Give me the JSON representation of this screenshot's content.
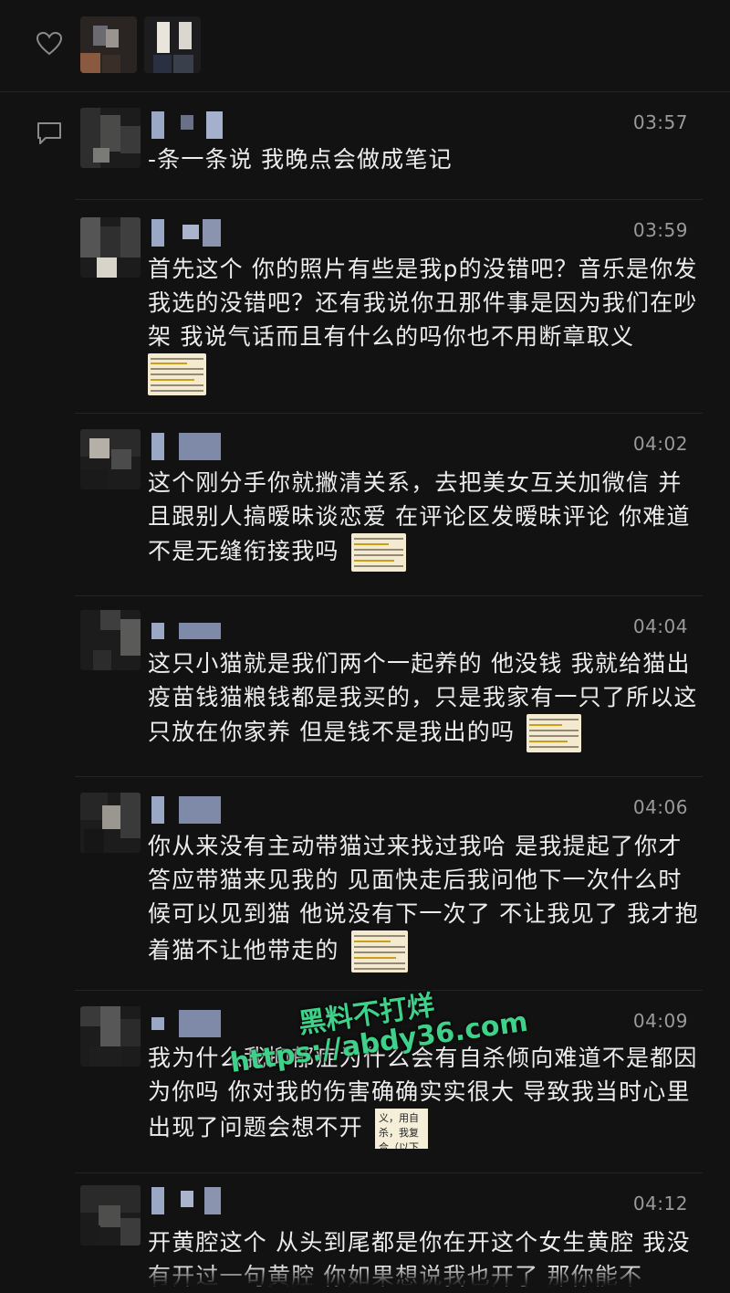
{
  "likes": {
    "icon": "heart-icon"
  },
  "comments_icon": "comment-icon",
  "watermark": {
    "line1": "黑料不打烊",
    "line2": "https://abdy36.com"
  },
  "comments": [
    {
      "time": "03:57",
      "text": "-条一条说 我晚点会做成笔记",
      "thumb": null
    },
    {
      "time": "03:59",
      "text": "首先这个 你的照片有些是我p的没错吧？音乐是你发我选的没错吧？还有我说你丑那件事是因为我们在吵架 我说气话而且有什么的吗你也不用断章取义",
      "thumb": "note"
    },
    {
      "time": "04:02",
      "text": "这个刚分手你就撇清关系，去把美女互关加微信 并且跟别人搞暧昧谈恋爱 在评论区发暧昧评论 你难道不是无缝衔接我吗",
      "thumb": "note"
    },
    {
      "time": "04:04",
      "text": "这只小猫就是我们两个一起养的 他没钱 我就给猫出疫苗钱猫粮钱都是我买的，只是我家有一只了所以这只放在你家养 但是钱不是我出的吗",
      "thumb": "note"
    },
    {
      "time": "04:06",
      "text": "你从来没有主动带猫过来找过我哈 是我提起了你才答应带猫来见我的 见面快走后我问他下一次什么时候可以见到猫 他说没有下一次了 不让我见了 我才抱着猫不让他带走的",
      "thumb": "note"
    },
    {
      "time": "04:09",
      "text": "我为什么我抑郁症为什么会有自杀倾向难道不是都因为你吗 你对我的伤害确确实实很大 导致我当时心里出现了问题会想不开",
      "thumb": "text",
      "thumb_text": "义，用自杀，我复合（以下"
    },
    {
      "time": "04:12",
      "text": "开黄腔这个 从头到尾都是你在开这个女生黄腔 我没有开过一句黄腔 你如果想说我也开了 那你能不",
      "thumb": null
    }
  ]
}
